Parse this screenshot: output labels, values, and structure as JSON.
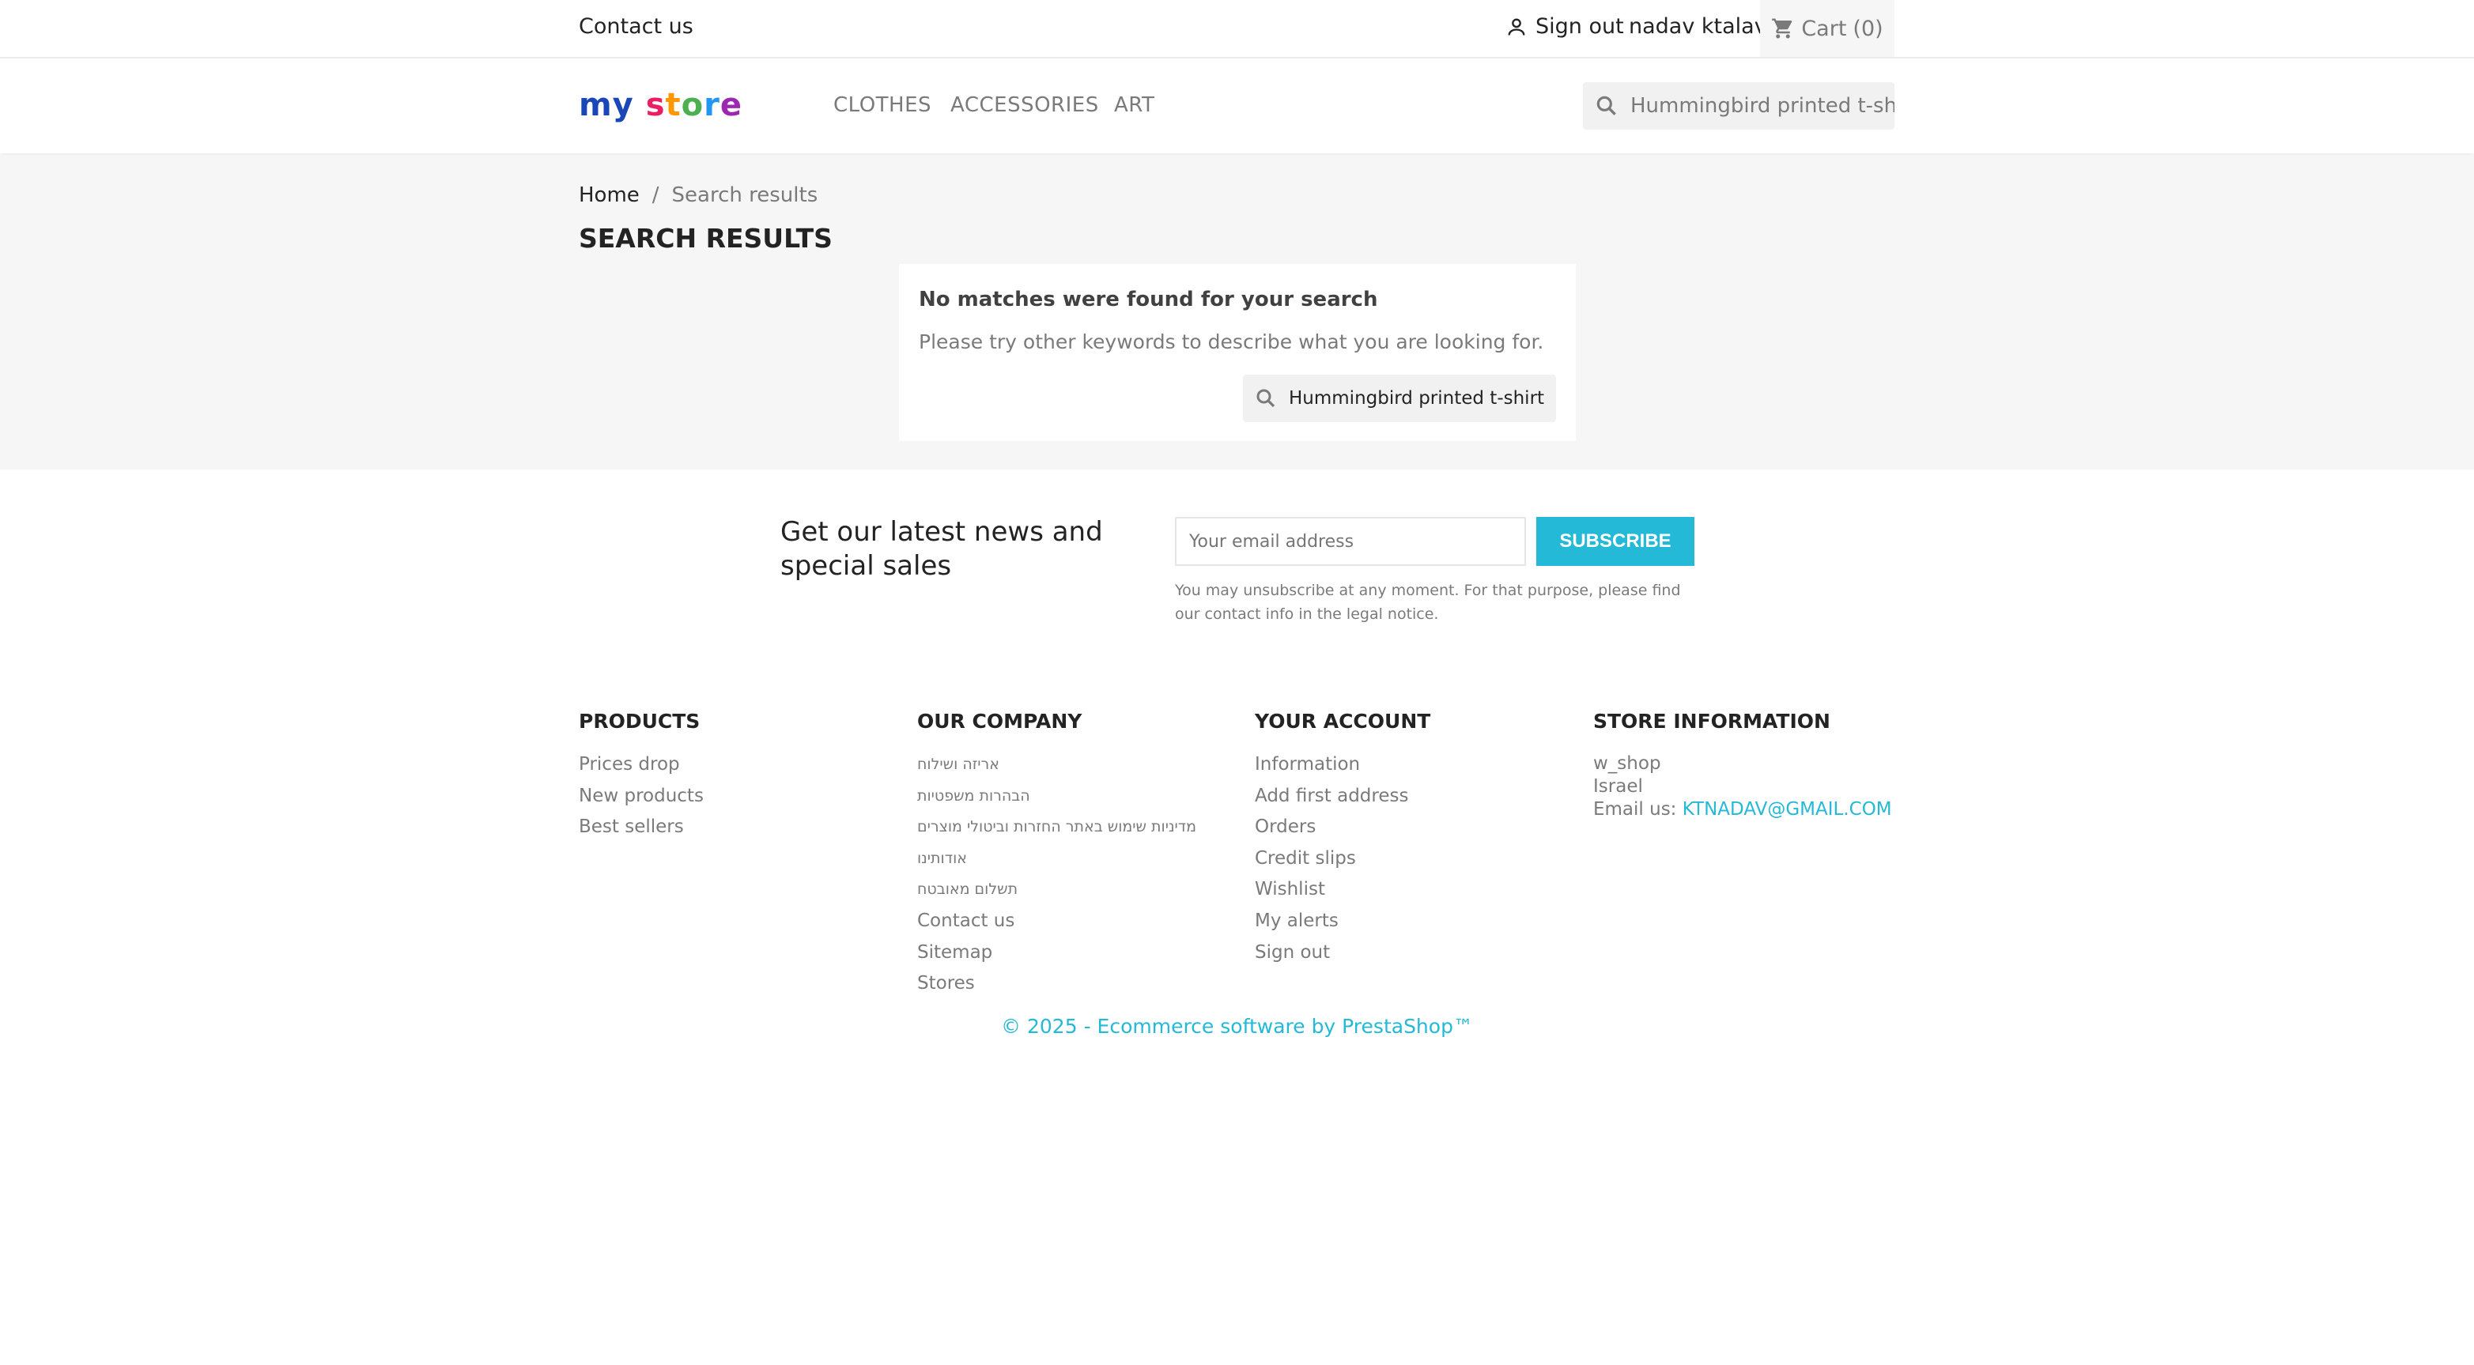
{
  "topbar": {
    "contact_label": "Contact us",
    "signout_label": "Sign out",
    "username": "nadav ktalav",
    "cart_label": "Cart",
    "cart_count": "(0)",
    "user_icon": "user-icon",
    "cart_icon": "cart-icon"
  },
  "header": {
    "logo_my": "my",
    "logo_store": "store",
    "nav": [
      "CLOTHES",
      "ACCESSORIES",
      "ART"
    ],
    "search_value": "Hummingbird printed t-shirt",
    "search_icon": "search-icon"
  },
  "breadcrumb": {
    "home": "Home",
    "separator": "/",
    "current": "Search results"
  },
  "main": {
    "title": "SEARCH RESULTS",
    "no_match": "No matches were found for your search",
    "try_text": "Please try other keywords to describe what you are looking for.",
    "search_value": "Hummingbird printed t-shirt"
  },
  "newsletter": {
    "title": "Get our latest news and special sales",
    "email_placeholder": "Your email address",
    "subscribe_label": "SUBSCRIBE",
    "note": "You may unsubscribe at any moment. For that purpose, please find our contact info in the legal notice."
  },
  "footer": {
    "products": {
      "title": "PRODUCTS",
      "items": [
        "Prices drop",
        "New products",
        "Best sellers"
      ]
    },
    "company": {
      "title": "OUR COMPANY",
      "items": [
        "אריזה ושילוח",
        "הבהרות משפטיות",
        "מדיניות שימוש באתר החזרות וביטולי מוצרים",
        "אודותינו",
        "תשלום מאובטח",
        "Contact us",
        "Sitemap",
        "Stores"
      ]
    },
    "account": {
      "title": "YOUR ACCOUNT",
      "items": [
        "Information",
        "Add first address",
        "Orders",
        "Credit slips",
        "Wishlist",
        "My alerts",
        "Sign out"
      ]
    },
    "store": {
      "title": "STORE INFORMATION",
      "name": "w_shop",
      "country": "Israel",
      "email_label": "Email us:",
      "email": "KTNADAV@GMAIL.COM"
    },
    "copyright": "© 2025 - Ecommerce software by PrestaShop™"
  },
  "colors": {
    "accent": "#24b9d7",
    "text": "#232323",
    "muted": "#7a7a7a",
    "wrapper_bg": "#f6f6f6"
  }
}
